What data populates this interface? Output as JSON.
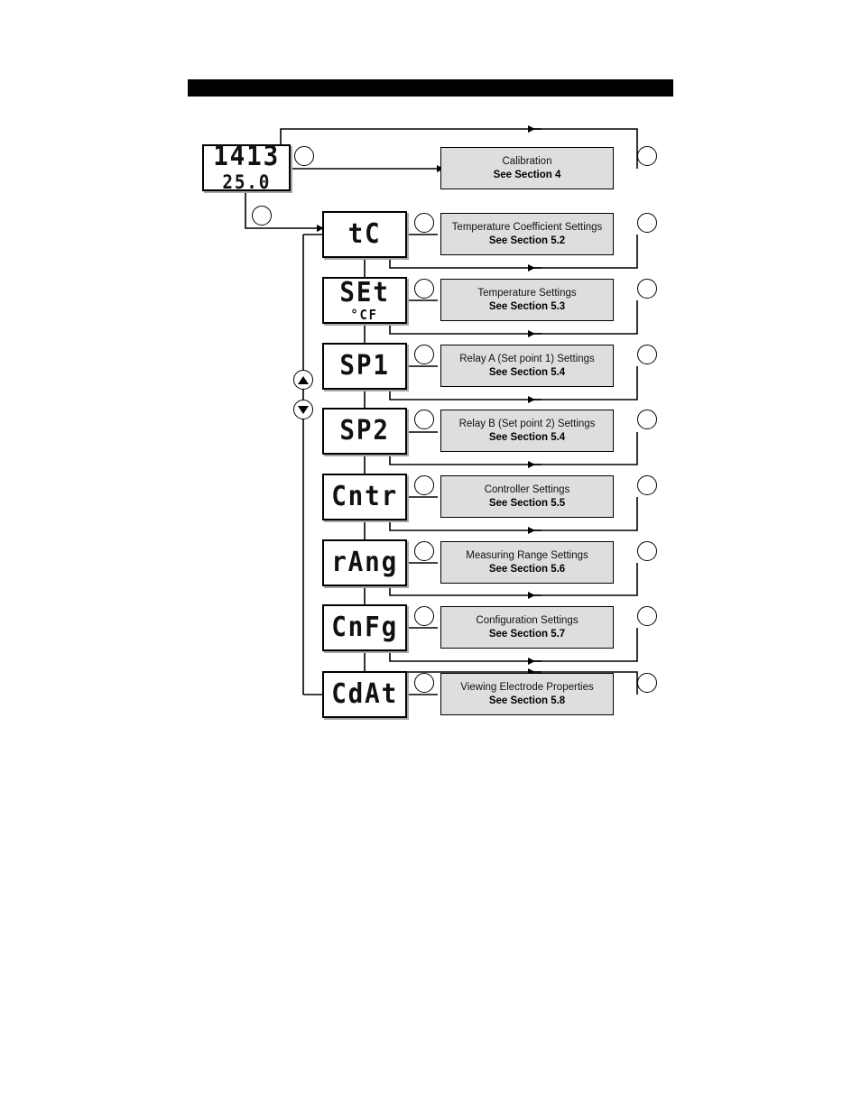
{
  "page": {
    "header_bar_color": "#000000",
    "desc_box_fill": "#dedede",
    "lcd_box_fill": "#ffffff"
  },
  "display": {
    "name": "instrument-lcd-display",
    "main_value": "1413",
    "sub_value": "25.0"
  },
  "nav_keys": {
    "up_icon": "triangle-up-icon",
    "down_icon": "triangle-down-icon"
  },
  "menu_items": [
    {
      "code": "tC",
      "code_sub": "",
      "title": "Temperature Coefficient Settings",
      "section": "See Section 5.2"
    },
    {
      "code": "SEt",
      "code_sub": "°CF",
      "title": "Temperature Settings",
      "section": "See Section 5.3"
    },
    {
      "code": "SP1",
      "code_sub": "",
      "title": "Relay A (Set point 1) Settings",
      "section": "See Section 5.4"
    },
    {
      "code": "SP2",
      "code_sub": "",
      "title": "Relay B (Set point 2) Settings",
      "section": "See Section 5.4"
    },
    {
      "code": "Cntr",
      "code_sub": "",
      "title": "Controller Settings",
      "section": "See Section 5.5"
    },
    {
      "code": "rAng",
      "code_sub": "",
      "title": "Measuring Range Settings",
      "section": "See Section 5.6"
    },
    {
      "code": "CnFg",
      "code_sub": "",
      "title": "Configuration Settings",
      "section": "See Section 5.7"
    },
    {
      "code": "CdAt",
      "code_sub": "",
      "title": "Viewing Electrode Properties",
      "section": "See Section 5.8"
    }
  ],
  "calibration": {
    "title": "Calibration",
    "section": "See Section 4"
  }
}
